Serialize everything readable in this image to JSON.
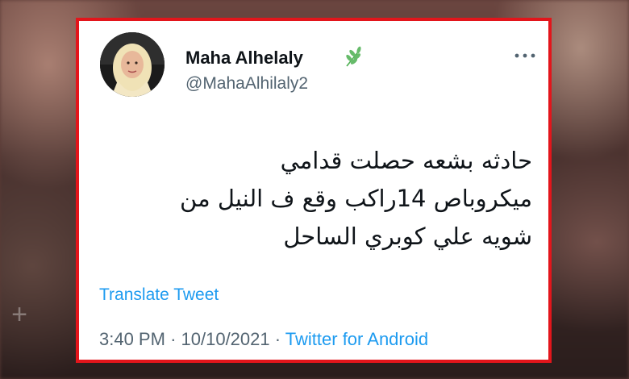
{
  "tweet": {
    "author_name": "Maha Alhelaly",
    "author_handle": "@MahaAlhilaly2",
    "name_badge_icon": "leaf-icon",
    "more_icon": "more-options-icon",
    "body_lines": [
      "حادثه بشعه حصلت قدامي",
      "ميكروباص 14راكب وقع ف النيل من",
      "شويه علي كوبري الساحل"
    ],
    "translate_label": "Translate Tweet",
    "time": "3:40 PM",
    "separator": "·",
    "date": "10/10/2021",
    "source": "Twitter for Android"
  },
  "colors": {
    "frame_border": "#e3151b",
    "link": "#1d9bf0",
    "secondary_text": "#536471",
    "primary_text": "#0f1419"
  }
}
